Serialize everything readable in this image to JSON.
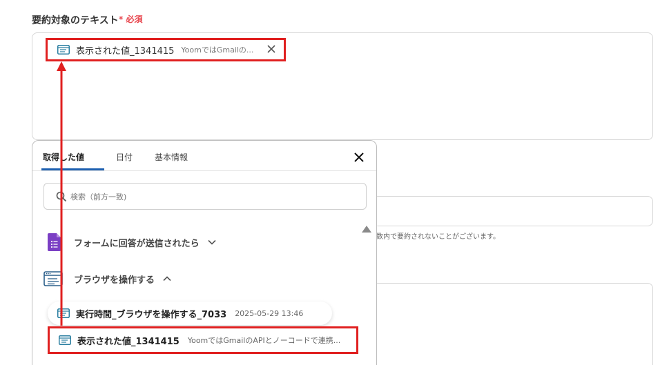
{
  "field": {
    "label": "要約対象のテキスト",
    "required_star": "*",
    "required_text": "必須"
  },
  "chip": {
    "title": "表示された値_1341415",
    "subtitle": "YoomではGmailの..."
  },
  "hint": {
    "text": "数内で要約されないことがございます。"
  },
  "tabs": [
    {
      "label": "取得した値",
      "active": true
    },
    {
      "label": "日付",
      "active": false
    },
    {
      "label": "基本情報",
      "active": false
    }
  ],
  "search": {
    "placeholder": "検索（前方一致)"
  },
  "groups": [
    {
      "label": "フォームに回答が送信されたら",
      "icon": "form-icon",
      "expanded": false
    },
    {
      "label": "ブラウザを操作する",
      "icon": "browser-icon",
      "expanded": true
    }
  ],
  "items": [
    {
      "title": "実行時間_ブラウザを操作する_7033",
      "subtitle": "2025-05-29 13:46"
    },
    {
      "title": "表示された値_1341415",
      "subtitle": "YoomではGmailのAPIとノーコードで連携..."
    }
  ],
  "colors": {
    "required": "#e8474f",
    "highlight": "#e02020",
    "tab_active": "#1d5fb0",
    "form_icon": "#7b3fc4",
    "value_icon": "#2a7ea0"
  }
}
